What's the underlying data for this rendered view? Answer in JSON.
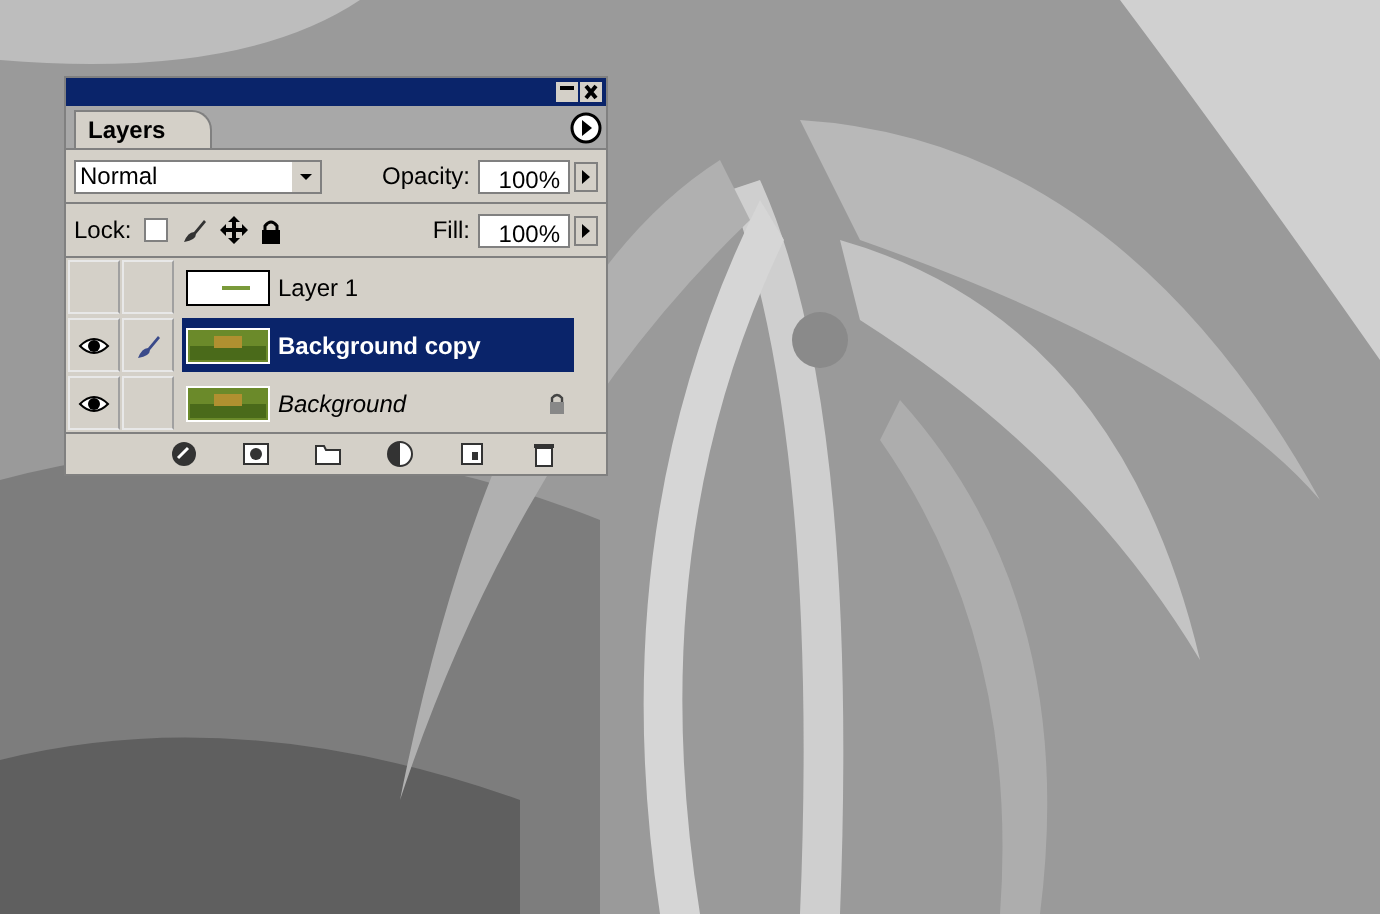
{
  "panel": {
    "tabs": [
      {
        "label": "Layers",
        "selected": true
      }
    ],
    "blend_mode": "Normal",
    "opacity_label": "Opacity:",
    "opacity": "100%",
    "lock_label": "Lock:",
    "fill_label": "Fill:",
    "fill": "100%",
    "layers": [
      {
        "name": "Layer 1",
        "kind": "transparent",
        "visible": false,
        "brush": false,
        "selected": false,
        "locked": false
      },
      {
        "name": "Background copy",
        "visible": true,
        "brush": true,
        "selected": true,
        "locked": false
      },
      {
        "name": "Background",
        "kind": "background",
        "visible": true,
        "brush": false,
        "selected": false,
        "locked": true
      }
    ]
  }
}
